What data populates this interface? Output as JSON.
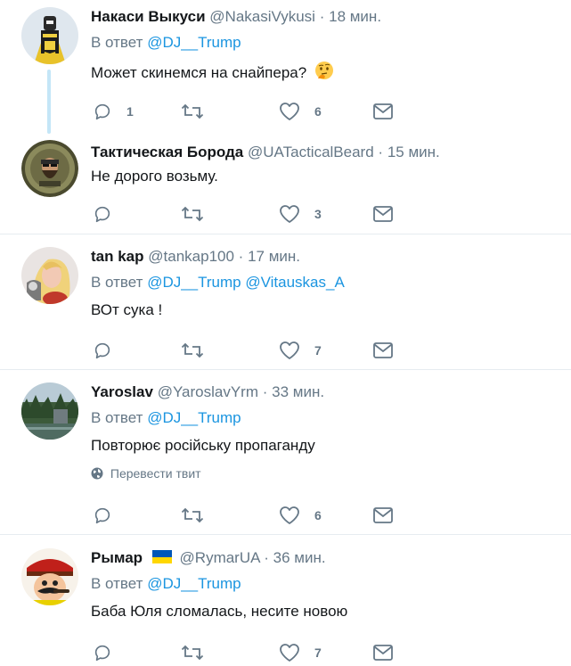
{
  "tweets": [
    {
      "name": "Накаси Выкуси",
      "handle": "@NakasiVykusi",
      "dot": "·",
      "time": "18 мин.",
      "reply_prefix": "В ответ",
      "mentions": [
        "@DJ__Trump"
      ],
      "text": "Может скинемся на снайпера?",
      "emoji": "thinking-face-emoji",
      "reply_count": "1",
      "retweet_count": "",
      "like_count": "6"
    },
    {
      "name": "Тактическая Борода",
      "handle": "@UATacticalBeard",
      "dot": "·",
      "time": "15 мин.",
      "text": "Не дорого возьму.",
      "reply_count": "",
      "retweet_count": "",
      "like_count": "3"
    },
    {
      "name": "tan kap",
      "handle": "@tankap100",
      "dot": "·",
      "time": "17 мин.",
      "reply_prefix": "В ответ",
      "mentions": [
        "@DJ__Trump",
        "@Vitauskas_A"
      ],
      "text": "ВОт сука !",
      "reply_count": "",
      "retweet_count": "",
      "like_count": "7"
    },
    {
      "name": "Yaroslav",
      "handle": "@YaroslavYrm",
      "dot": "·",
      "time": "33 мин.",
      "reply_prefix": "В ответ",
      "mentions": [
        "@DJ__Trump"
      ],
      "text": "Повторює російську пропаганду",
      "translate": "Перевести твит",
      "reply_count": "",
      "retweet_count": "",
      "like_count": "6"
    },
    {
      "name": "Рымар",
      "handle": "@RymarUA",
      "dot": "·",
      "time": "36 мин.",
      "reply_prefix": "В ответ",
      "mentions": [
        "@DJ__Trump"
      ],
      "text": "Баба Юля сломалась, несите новою",
      "reply_count": "",
      "retweet_count": "",
      "like_count": "7"
    }
  ],
  "colors": {
    "text": "#14171a",
    "secondary": "#657786",
    "link": "#1b95e0",
    "thread_line": "#c4e6f7",
    "separator": "#e6ecf0",
    "flag_blue": "#0057b7",
    "flag_yellow": "#ffd700"
  },
  "icons": [
    "reply-icon",
    "retweet-icon",
    "like-icon",
    "direct-message-icon",
    "globe-icon"
  ]
}
